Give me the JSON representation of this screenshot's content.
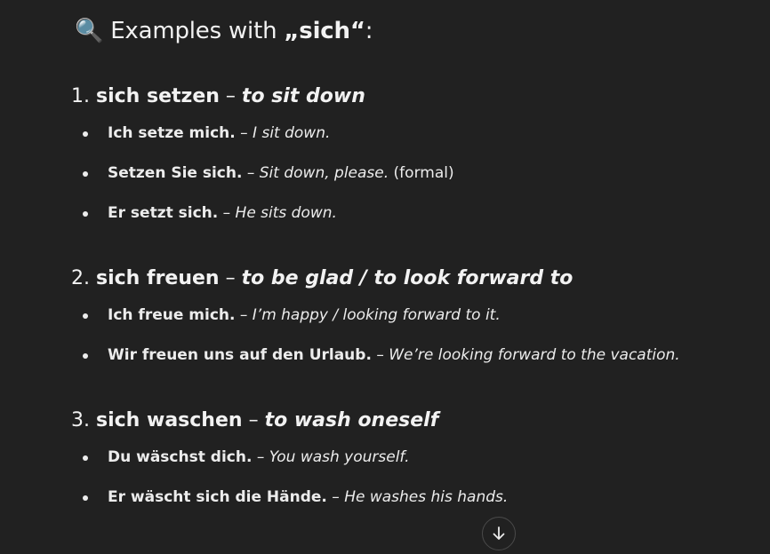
{
  "heading": {
    "emoji": "🔍",
    "prefix": "Examples with ",
    "keyword": "„sich“",
    "suffix": ":"
  },
  "sections": [
    {
      "number": "1.",
      "verb": "sich setzen",
      "dash": "–",
      "translation": "to sit down",
      "examples": [
        {
          "german": "Ich setze mich.",
          "dash": "–",
          "english": "I sit down.",
          "note": ""
        },
        {
          "german": "Setzen Sie sich.",
          "dash": "–",
          "english": "Sit down, please.",
          "note": "(formal)"
        },
        {
          "german": "Er setzt sich.",
          "dash": "–",
          "english": "He sits down.",
          "note": ""
        }
      ]
    },
    {
      "number": "2.",
      "verb": "sich freuen",
      "dash": "–",
      "translation": "to be glad / to look forward to",
      "examples": [
        {
          "german": "Ich freue mich.",
          "dash": "–",
          "english": "I’m happy / looking forward to it.",
          "note": ""
        },
        {
          "german": "Wir freuen uns auf den Urlaub.",
          "dash": "–",
          "english": "We’re looking forward to the vacation.",
          "note": ""
        }
      ]
    },
    {
      "number": "3.",
      "verb": "sich waschen",
      "dash": "–",
      "translation": "to wash oneself",
      "examples": [
        {
          "german": "Du wäschst dich.",
          "dash": "–",
          "english": "You wash yourself.",
          "note": ""
        },
        {
          "german": "Er wäscht sich die Hände.",
          "dash": "–",
          "english": "He washes his hands.",
          "note": ""
        }
      ]
    }
  ],
  "scroll_button": {
    "icon": "arrow-down-icon"
  }
}
